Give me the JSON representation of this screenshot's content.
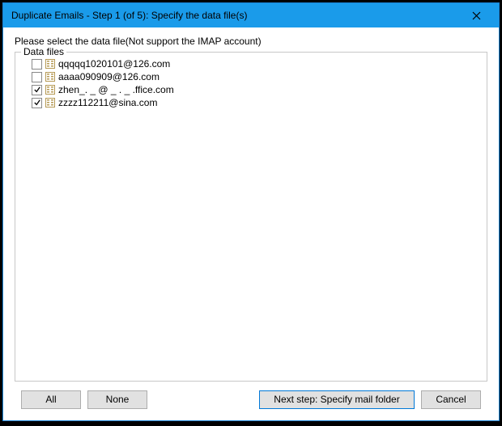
{
  "window": {
    "title": "Duplicate Emails - Step 1 (of 5): Specify the data file(s)"
  },
  "instruction": "Please select the data file(Not support the IMAP account)",
  "fieldset": {
    "legend": "Data files"
  },
  "files": [
    {
      "checked": false,
      "label": "qqqqq1020101@126.com"
    },
    {
      "checked": false,
      "label": "aaaa090909@126.com"
    },
    {
      "checked": true,
      "label": "zhen_.  _ @ _ . _  .ffice.com"
    },
    {
      "checked": true,
      "label": "zzzz112211@sina.com"
    }
  ],
  "buttons": {
    "all": "All",
    "none": "None",
    "next": "Next step: Specify mail folder",
    "cancel": "Cancel"
  }
}
